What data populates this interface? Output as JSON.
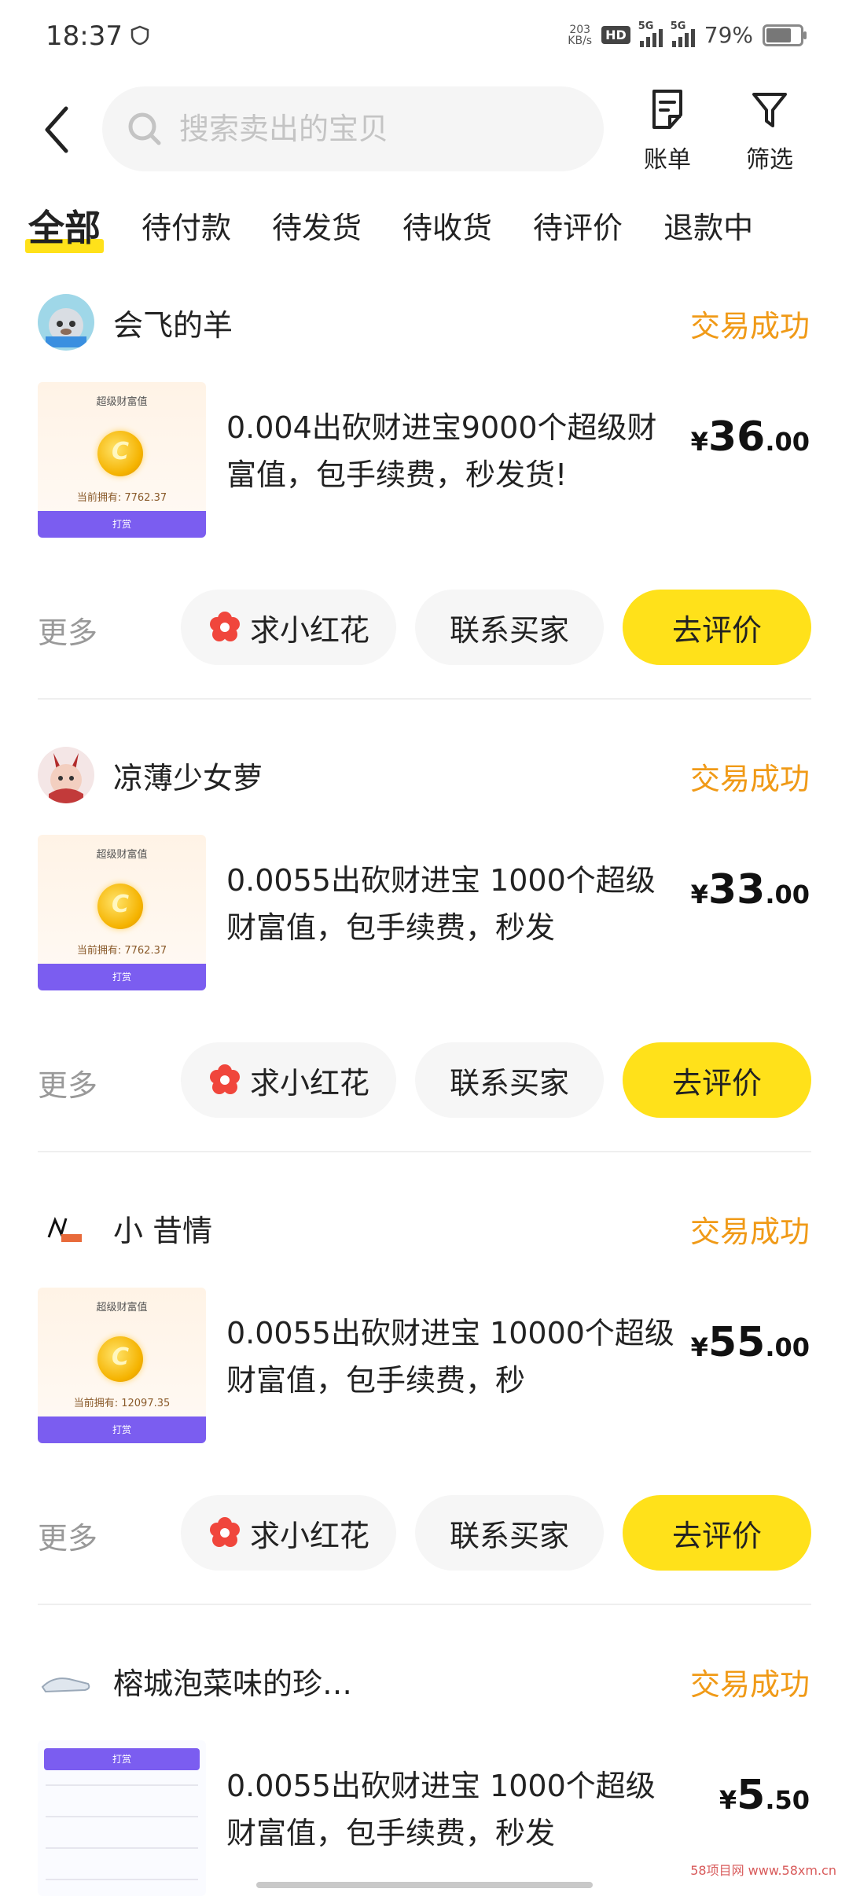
{
  "status_bar": {
    "time": "18:37",
    "net_speed_value": "203",
    "net_speed_unit": "KB/s",
    "hd_label": "HD",
    "signal1": "5G",
    "signal2": "5G",
    "battery": "79%"
  },
  "header": {
    "search_placeholder": "搜索卖出的宝贝",
    "bill_label": "账单",
    "filter_label": "筛选"
  },
  "tabs": [
    {
      "label": "全部"
    },
    {
      "label": "待付款"
    },
    {
      "label": "待发货"
    },
    {
      "label": "待收货"
    },
    {
      "label": "待评价"
    },
    {
      "label": "退款中"
    }
  ],
  "orders": [
    {
      "seller": "会飞的羊",
      "status": "交易成功",
      "thumb_title": "超级财富值",
      "thumb_balance": "当前拥有: 7762.37",
      "thumb_button": "打赏",
      "title": "0.004出砍财进宝9000个超级财富值，包手续费，秒发货!",
      "price_currency": "¥",
      "price_int": "36",
      "price_dec": ".00",
      "more": "更多",
      "flower_btn": "求小红花",
      "contact_btn": "联系买家",
      "review_btn": "去评价"
    },
    {
      "seller": "凉薄少女萝",
      "status": "交易成功",
      "thumb_title": "超级财富值",
      "thumb_balance": "当前拥有: 7762.37",
      "thumb_button": "打赏",
      "title": "0.0055出砍财进宝 1000个超级财富值，包手续费，秒发",
      "price_currency": "¥",
      "price_int": "33",
      "price_dec": ".00",
      "more": "更多",
      "flower_btn": "求小红花",
      "contact_btn": "联系买家",
      "review_btn": "去评价"
    },
    {
      "seller": "小 昔情",
      "status": "交易成功",
      "thumb_title": "超级财富值",
      "thumb_balance": "当前拥有: 12097.35",
      "thumb_button": "打赏",
      "title": "0.0055出砍财进宝 10000个超级财富值，包手续费，秒",
      "price_currency": "¥",
      "price_int": "55",
      "price_dec": ".00",
      "more": "更多",
      "flower_btn": "求小红花",
      "contact_btn": "联系买家",
      "review_btn": "去评价"
    },
    {
      "seller": "榕城泡菜味的珍…",
      "status": "交易成功",
      "thumb_title": "打赏",
      "thumb_balance": "",
      "thumb_button": "",
      "title": "0.0055出砍财进宝 1000个超级财富值，包手续费，秒发",
      "price_currency": "¥",
      "price_int": "5",
      "price_dec": ".50"
    }
  ],
  "watermark": "58项目网 www.58xm.cn"
}
